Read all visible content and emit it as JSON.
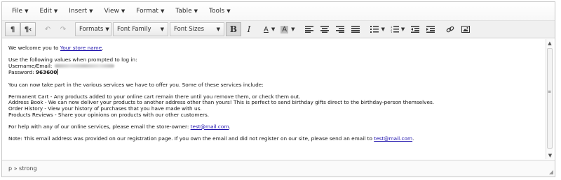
{
  "menubar": {
    "items": [
      "File",
      "Edit",
      "Insert",
      "View",
      "Format",
      "Table",
      "Tools"
    ]
  },
  "toolbar": {
    "formats_label": "Formats",
    "font_family_label": "Font Family",
    "font_sizes_label": "Font Sizes",
    "bold_label": "B",
    "italic_label": "I",
    "text_color_label": "A",
    "bg_color_label": "A"
  },
  "content": {
    "welcome_prefix": "We welcome you to ",
    "store_link": "Your store name",
    "welcome_suffix": ".",
    "login_intro": "Use the following values when prompted to log in:",
    "username_label": "Username/Email:",
    "password_label": "Password: ",
    "password_value": "963600",
    "services_intro": "You can now take part in the various services we have to offer you. Some of these services include:",
    "services": [
      "Permanent Cart - Any products added to your online cart remain there until you remove them, or check them out.",
      "Address Book - We can now deliver your products to another address other than yours! This is perfect to send birthday gifts direct to the birthday-person themselves.",
      "Order History - View your history of purchases that you have made with us.",
      "Products Reviews - Share your opinions on products with our other customers."
    ],
    "help_text": "For help with any of our online services, please email the store-owner: ",
    "help_email": "test@mail.com",
    "help_suffix": ".",
    "note_text": "Note: This email address was provided on our registration page. If you own the email and did not register on our site, please send an email to ",
    "note_email": "test@mail.com",
    "note_suffix": "."
  },
  "statusbar": {
    "path": "p » strong"
  }
}
